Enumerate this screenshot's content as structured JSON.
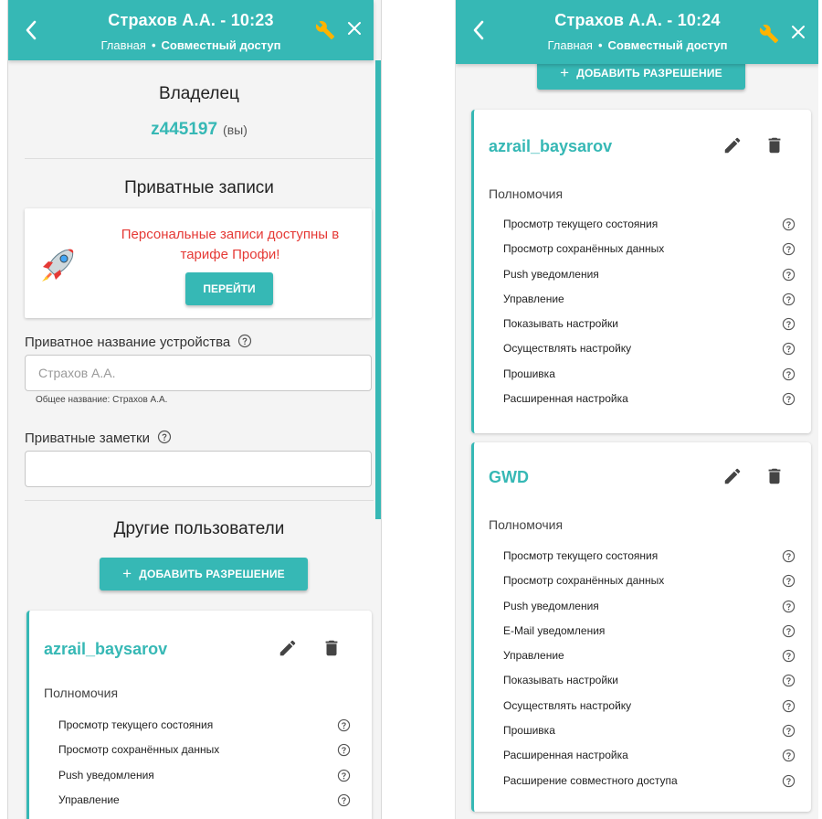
{
  "left": {
    "header": {
      "title": "Страхов А.А. - 10:23",
      "crumb_home": "Главная",
      "crumb_sep": "•",
      "crumb_current": "Совместный доступ"
    },
    "owner": {
      "title": "Владелец",
      "id": "z445197",
      "you": "(вы)"
    },
    "private": {
      "title": "Приватные записи",
      "promo_text": "Персональные записи доступны в тарифе Профи!",
      "go_button": "ПЕРЕЙТИ",
      "device_name_label": "Приватное название устройства",
      "device_name_placeholder": "Страхов А.А.",
      "device_name_hint": "Общее название: Страхов А.А.",
      "notes_label": "Приватные заметки",
      "notes_value": ""
    },
    "others": {
      "title": "Другие пользователи",
      "add_button": "ДОБАВИТЬ РАЗРЕШЕНИЕ",
      "user": {
        "name": "azrail_baysarov",
        "perm_title": "Полномочия",
        "perms": [
          "Просмотр текущего состояния",
          "Просмотр сохранённых данных",
          "Push уведомления",
          "Управление"
        ]
      }
    }
  },
  "right": {
    "header": {
      "title": "Страхов А.А. - 10:24",
      "crumb_home": "Главная",
      "crumb_sep": "•",
      "crumb_current": "Совместный доступ"
    },
    "add_button": "ДОБАВИТЬ РАЗРЕШЕНИЕ",
    "users": [
      {
        "name": "azrail_baysarov",
        "perm_title": "Полномочия",
        "perms": [
          "Просмотр текущего состояния",
          "Просмотр сохранённых данных",
          "Push уведомления",
          "Управление",
          "Показывать настройки",
          "Осуществлять настройку",
          "Прошивка",
          "Расширенная настройка"
        ]
      },
      {
        "name": "GWD",
        "perm_title": "Полномочия",
        "perms": [
          "Просмотр текущего состояния",
          "Просмотр сохранённых данных",
          "Push уведомления",
          "E-Mail уведомления",
          "Управление",
          "Показывать настройки",
          "Осуществлять настройку",
          "Прошивка",
          "Расширенная настройка",
          "Расширение совместного доступа"
        ]
      }
    ]
  },
  "colors": {
    "accent": "#36b8b5",
    "promo_text": "#e53935",
    "wrench": "#ffb300"
  },
  "icons": {
    "back": "chevron-left-icon",
    "settings": "wrench-icon",
    "close": "close-icon",
    "help": "help-circle-icon",
    "edit": "pencil-icon",
    "delete": "trash-icon",
    "promo": "rocket-icon"
  }
}
